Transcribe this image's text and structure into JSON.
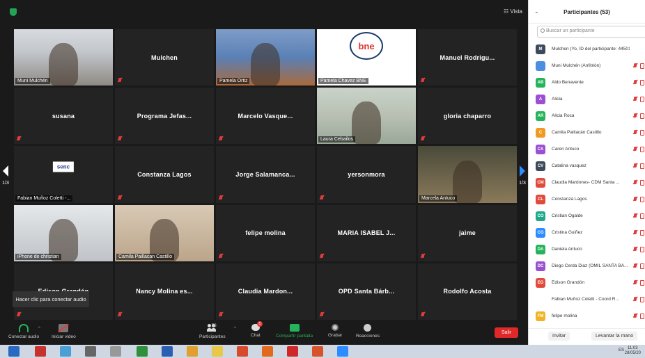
{
  "meeting": {
    "view_label": "☷ Vista",
    "page_indicator_left": "1/3",
    "page_indicator_right": "1/3",
    "tiles": [
      {
        "label": "Muni Mulchén",
        "video": "v1"
      },
      {
        "name": "Mulchen"
      },
      {
        "label": "Pamela Ortiz",
        "video": "v3",
        "active": true
      },
      {
        "label": "Pamela Chavez BNE",
        "video": "v4",
        "logo": "bne"
      },
      {
        "name": "Manuel Rodrigu..."
      },
      {
        "name": "susana"
      },
      {
        "name": "Programa Jefas..."
      },
      {
        "name": "Marcelo Vasque..."
      },
      {
        "label": "Laura Cebailos",
        "video": "v5"
      },
      {
        "name": "gloria chaparro"
      },
      {
        "label": "Fabian Muñoz Coletti -...",
        "video": "v2",
        "logo": "senc"
      },
      {
        "name": "Constanza Lagos"
      },
      {
        "name": "Jorge Salamanca..."
      },
      {
        "name": "yersonmora"
      },
      {
        "label": "Marcela Antuco",
        "video": "v6"
      },
      {
        "label": "iPhone de christian",
        "video": "v7"
      },
      {
        "label": "Camila Paillacan Castillo",
        "video": "v8"
      },
      {
        "name": "felipe molina"
      },
      {
        "name": "MARIA ISABEL J..."
      },
      {
        "name": "jaime"
      },
      {
        "name": "Edison Grandón"
      },
      {
        "name": "Nancy Molina es..."
      },
      {
        "name": "Claudia Mardon..."
      },
      {
        "name": "OPD Santa Bárb..."
      },
      {
        "name": "Rodolfo Acosta"
      }
    ],
    "tooltip": "Hacer clic para conectar audio",
    "logos": {
      "bne": "bne",
      "senc": "senc"
    }
  },
  "toolbar": {
    "audio": "Conectar audio",
    "video": "Iniciar video",
    "participants": "Participantes",
    "participants_count": "53",
    "chat": "Chat",
    "chat_badge": "5",
    "share": "Compartir pantalla",
    "record": "Grabar",
    "reactions": "Reacciones",
    "leave": "Salir"
  },
  "panel": {
    "title": "Participantes (53)",
    "search_placeholder": "Buscar un participante",
    "participants": [
      {
        "initials": "M",
        "color": "#3d4a5c",
        "name": "Mulchen (Yo, ID del participante: 445012"
      },
      {
        "initials": "",
        "color": "#4a8fe0",
        "name": "Muni Mulchén (Anfitrión)"
      },
      {
        "initials": "AB",
        "color": "#25b35c",
        "name": "Aldo Benavente"
      },
      {
        "initials": "A",
        "color": "#9b4fd1",
        "name": "Alicia"
      },
      {
        "initials": "AR",
        "color": "#25b35c",
        "name": "Alicia Roca"
      },
      {
        "initials": "C",
        "color": "#f09a24",
        "name": "Camila Paillacán Castillo"
      },
      {
        "initials": "CA",
        "color": "#9b4fd1",
        "name": "Caren Antuco"
      },
      {
        "initials": "CV",
        "color": "#3d4a5c",
        "name": "Catalina vasquez"
      },
      {
        "initials": "CM",
        "color": "#e04b3b",
        "name": "Claudia Mardones- CDM Santa ..."
      },
      {
        "initials": "CL",
        "color": "#e04b3b",
        "name": "Constanza Lagos"
      },
      {
        "initials": "CO",
        "color": "#1fa88a",
        "name": "Cristian Ogalde"
      },
      {
        "initials": "CG",
        "color": "#2d8cff",
        "name": "Cristina Guiñez"
      },
      {
        "initials": "DA",
        "color": "#25b35c",
        "name": "Daniela Antuco"
      },
      {
        "initials": "DC",
        "color": "#9b4fd1",
        "name": "Diego Cerda Diaz (OMIL SANTA BÁ..."
      },
      {
        "initials": "EG",
        "color": "#e04b3b",
        "name": "Edison Grandón"
      },
      {
        "initials": "",
        "color": "#ffffff",
        "name": "Fabian Muñoz Coletti - Coord R..."
      },
      {
        "initials": "FM",
        "color": "#f0b324",
        "name": "felipe molina"
      }
    ],
    "invite": "Invitar",
    "raise_hand": "Levantar la mano"
  },
  "taskbar": {
    "tray": "ES",
    "time": "11:03",
    "date": "28/05/20"
  }
}
